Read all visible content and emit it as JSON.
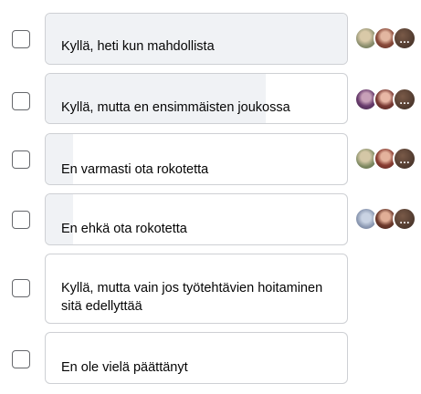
{
  "poll": {
    "options": [
      {
        "label": "Kyllä, heti kun mahdollista",
        "share": 1.0,
        "checked": false,
        "voters": [
          "voter-avatar",
          "voter-avatar",
          "more-voters-icon"
        ]
      },
      {
        "label": "Kyllä, mutta en ensimmäisten joukossa",
        "share": 0.73,
        "checked": false,
        "voters": [
          "voter-avatar",
          "voter-avatar",
          "more-voters-icon"
        ]
      },
      {
        "label": "En varmasti ota rokotetta",
        "share": 0.09,
        "checked": false,
        "voters": [
          "voter-avatar",
          "voter-avatar",
          "more-voters-icon"
        ]
      },
      {
        "label": "En ehkä ota rokotetta",
        "share": 0.09,
        "checked": false,
        "voters": [
          "voter-avatar",
          "voter-avatar",
          "more-voters-icon"
        ]
      },
      {
        "label": "Kyllä, mutta vain jos työtehtävien hoitaminen sitä edellyttää",
        "share": 0.0,
        "checked": false,
        "voters": []
      },
      {
        "label": "En ole vielä päättänyt",
        "share": 0.0,
        "checked": false,
        "voters": []
      }
    ],
    "more_glyph": "…",
    "colors": {
      "bar_fill": "#f0f2f5",
      "border": "#ced0d4",
      "text": "#050505"
    }
  }
}
